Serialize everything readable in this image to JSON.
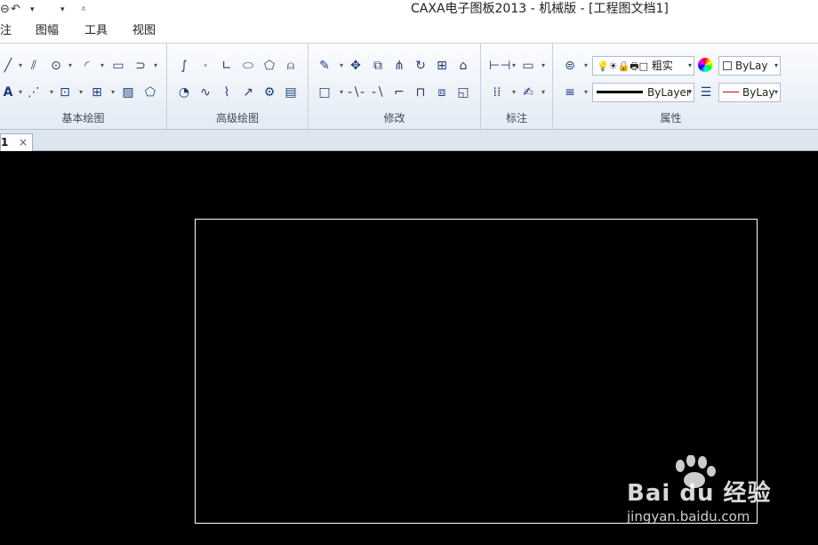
{
  "window": {
    "title": "CAXA电子图板2013 - 机械版 - [工程图文档1]"
  },
  "quick_access": {
    "save_icon": "save-icon",
    "undo_icon": "undo-icon",
    "dropdown_glyph": "▾",
    "customize_glyph": "⩡"
  },
  "menu": {
    "items": [
      {
        "label": "注"
      },
      {
        "label": "图幅"
      },
      {
        "label": "工具"
      },
      {
        "label": "视图"
      }
    ]
  },
  "ribbon": {
    "groups": [
      {
        "label": "基本绘图"
      },
      {
        "label": "高级绘图"
      },
      {
        "label": "修改"
      },
      {
        "label": "标注"
      },
      {
        "label": "属性"
      }
    ],
    "properties": {
      "line_style_value": "粗实",
      "color_value": "ByLay",
      "line_weight_value": "ByLayer",
      "line_type_value": "ByLay"
    }
  },
  "document": {
    "tab_label": "1",
    "tab_close_glyph": "×"
  },
  "watermark": {
    "brand_text": "Bai du 经验",
    "url_text": "jingyan.baidu.com"
  },
  "colors": {
    "canvas_bg": "#000000",
    "frame_stroke": "#ffffff",
    "ribbon_bg": "#e4ebf4"
  }
}
